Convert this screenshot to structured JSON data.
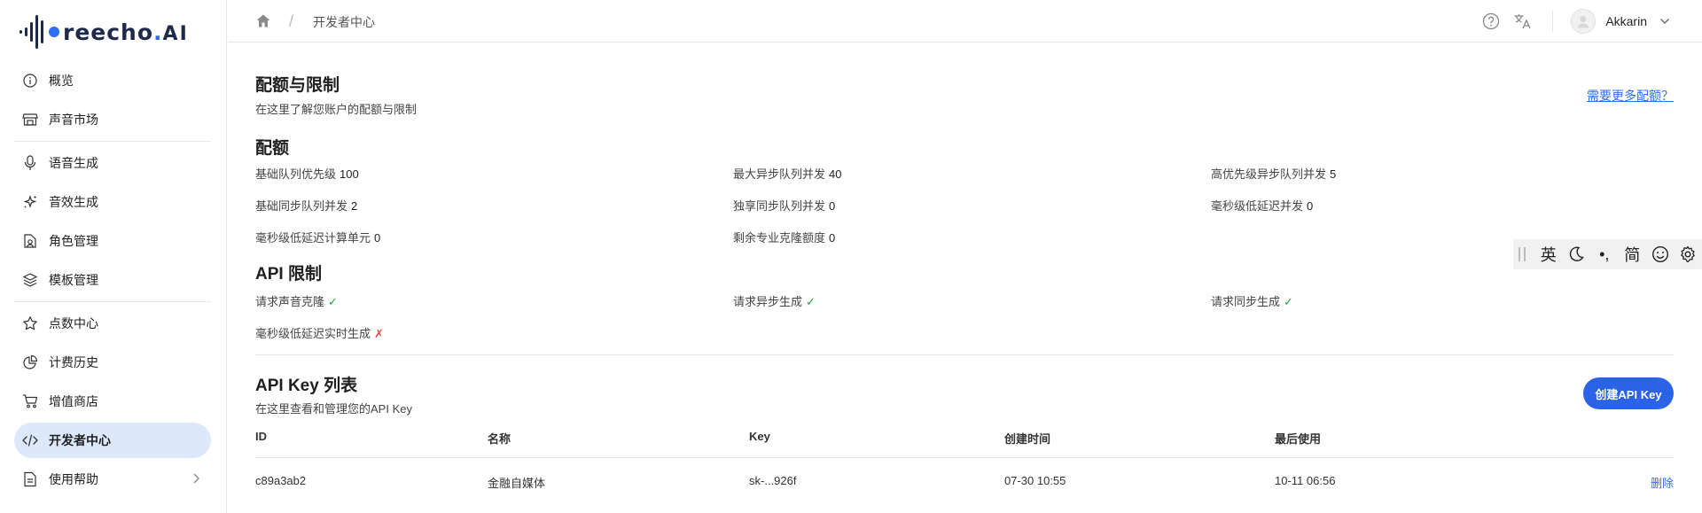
{
  "logo": {
    "text_main": "reech",
    "text_o": "o",
    "text_dot": ".",
    "text_ai": "AI"
  },
  "sidebar": {
    "items": [
      {
        "label": "概览",
        "icon": "info-icon"
      },
      {
        "label": "声音市场",
        "icon": "store-icon"
      },
      {
        "label": "语音生成",
        "icon": "microphone-icon"
      },
      {
        "label": "音效生成",
        "icon": "sparkles-icon"
      },
      {
        "label": "角色管理",
        "icon": "character-icon"
      },
      {
        "label": "模板管理",
        "icon": "layers-icon"
      },
      {
        "label": "点数中心",
        "icon": "star-icon"
      },
      {
        "label": "计费历史",
        "icon": "pie-chart-icon"
      },
      {
        "label": "增值商店",
        "icon": "cart-icon"
      },
      {
        "label": "开发者中心",
        "icon": "code-icon",
        "active": true
      },
      {
        "label": "使用帮助",
        "icon": "document-icon"
      }
    ]
  },
  "header": {
    "breadcrumb_current": "开发者中心",
    "username": "Akkarin"
  },
  "quota_section": {
    "title": "配额与限制",
    "subtitle": "在这里了解您账户的配额与限制",
    "more_link": "需要更多配额？",
    "quota_title": "配额",
    "quotas": [
      {
        "label": "基础队列优先级",
        "value": "100"
      },
      {
        "label": "最大异步队列并发",
        "value": "40"
      },
      {
        "label": "高优先级异步队列并发",
        "value": "5"
      },
      {
        "label": "基础同步队列并发",
        "value": "2"
      },
      {
        "label": "独享同步队列并发",
        "value": "0"
      },
      {
        "label": "毫秒级低延迟并发",
        "value": "0"
      },
      {
        "label": "毫秒级低延迟计算单元",
        "value": "0"
      },
      {
        "label": "剩余专业克隆额度",
        "value": "0"
      }
    ],
    "api_title": "API 限制",
    "limits": [
      {
        "label": "请求声音克隆",
        "mark": "✓"
      },
      {
        "label": "请求异步生成",
        "mark": "✓"
      },
      {
        "label": "请求同步生成",
        "mark": "✓"
      },
      {
        "label": "毫秒级低延迟实时生成",
        "mark": "✗"
      }
    ]
  },
  "apikey_section": {
    "title": "API Key 列表",
    "subtitle": "在这里查看和管理您的API Key",
    "create_button": "创建API Key",
    "columns": [
      "ID",
      "名称",
      "Key",
      "创建时间",
      "最后使用"
    ],
    "rows": [
      {
        "id": "c89a3ab2",
        "name": "金融自媒体",
        "key": "sk-...926f",
        "created": "07-30 10:55",
        "last_used": "10-11 06:56",
        "action": "删除"
      }
    ]
  },
  "ime_toolbar": {
    "lang": "英",
    "punct": "•,",
    "script": "简"
  }
}
